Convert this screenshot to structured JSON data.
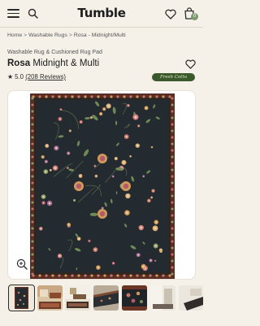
{
  "header": {
    "logo": "Tumble",
    "cart_count": "0",
    "icons": [
      "menu-icon",
      "search-icon",
      "heart-icon",
      "cart-icon"
    ]
  },
  "breadcrumb": {
    "items": [
      "Home",
      "Washable Rugs",
      "Rosa - Midnight/Multi"
    ],
    "separator": ">"
  },
  "product": {
    "subtitle": "Washable Rug & Cushioned Rug Pad",
    "name": "Rosa",
    "variant": "Midnight & Multi",
    "rating_star": "★",
    "rating_value": "5.0",
    "reviews": "(208 Reviews)",
    "badge": "Fresh Cotto"
  },
  "gallery": {
    "thumbnail_count": 7,
    "selected_index": 0
  },
  "colors": {
    "background": "#f5f1e8",
    "rug_field": "#232b30",
    "rug_border": "#5a2e22",
    "badge": "#3a5a2c"
  }
}
